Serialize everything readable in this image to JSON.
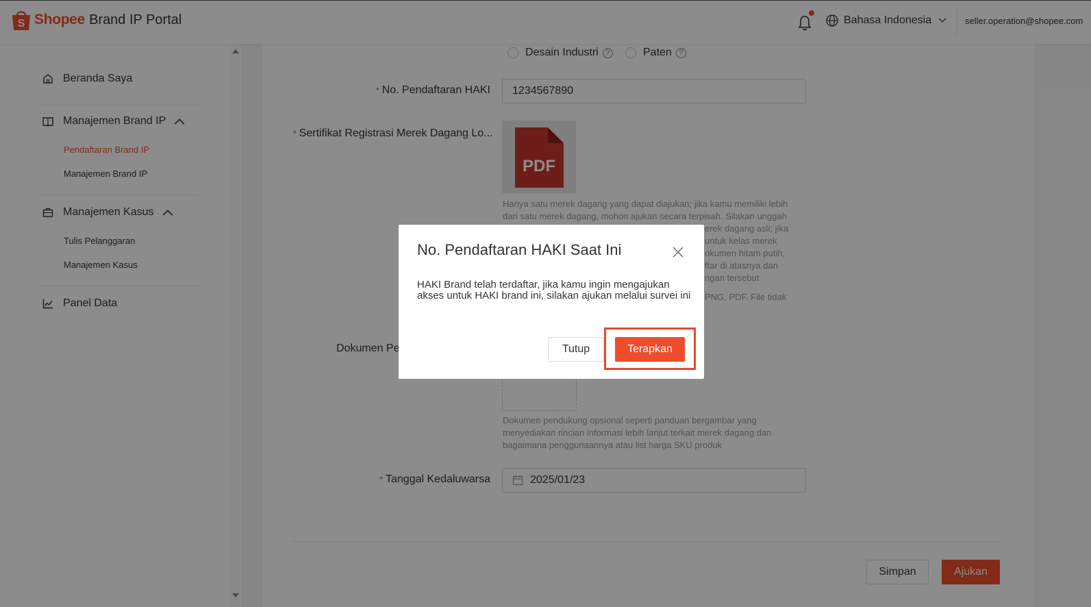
{
  "header": {
    "brand": "Shopee",
    "portal": "Brand IP Portal",
    "language": "Bahasa Indonesia",
    "account_email": "seller.operation@shopee.com"
  },
  "sidebar": {
    "home": "Beranda Saya",
    "brand_mgmt": "Manajemen Brand IP",
    "brand_sub": [
      "Pendaftaran Brand IP",
      "Manajemen Brand IP"
    ],
    "case_mgmt": "Manajemen Kasus",
    "case_sub": [
      "Tulis Pelanggaran",
      "Manajemen Kasus"
    ],
    "data_panel": "Panel Data"
  },
  "form": {
    "ip_types": [
      "Desain Industri",
      "Paten"
    ],
    "reg_no_label": "No. Pendaftaran HAKI",
    "reg_no_value": "1234567890",
    "cert_label": "Sertifikat Registrasi Merek Dagang Lo...",
    "pdf_label": "PDF",
    "cert_hint_lines": [
      "Hanya satu merek dagang yang dapat diajukan; jika kamu memiliki lebih",
      "dari satu merek dagang, mohon ajukan secara terpisah. Silakan unggah",
      "",
      "",
      "",
      "",
      ""
    ],
    "cert_hint_visible_fragments": [
      "erek dagang asli; jika",
      "untuk kelas merek",
      "okumen hitam putih,",
      "ftar di atasnya dan",
      "ngan tersebut",
      "PNG, PDF. File tidak"
    ],
    "support_doc_label": "Dokumen Per",
    "support_hint": "Dokumen pendukung opsional seperti panduan bergambar yang menyediakan rincian informasi lebih lanjut terkait merek dagang dan bagaimana penggunaannya atau list harga SKU produk",
    "expiry_label": "Tanggal Kedaluwarsa",
    "expiry_value": "2025/01/23",
    "save_button": "Simpan",
    "submit_button": "Ajukan"
  },
  "modal": {
    "title": "No. Pendaftaran HAKI Saat Ini",
    "body": "HAKI Brand telah terdaftar, jika kamu ingin mengajukan akses untuk HAKI brand ini, silakan ajukan melalui survei ini",
    "close_button": "Tutup",
    "apply_button": "Terapkan"
  },
  "colors": {
    "accent": "#ee4d2d",
    "highlight": "#e8472f"
  }
}
